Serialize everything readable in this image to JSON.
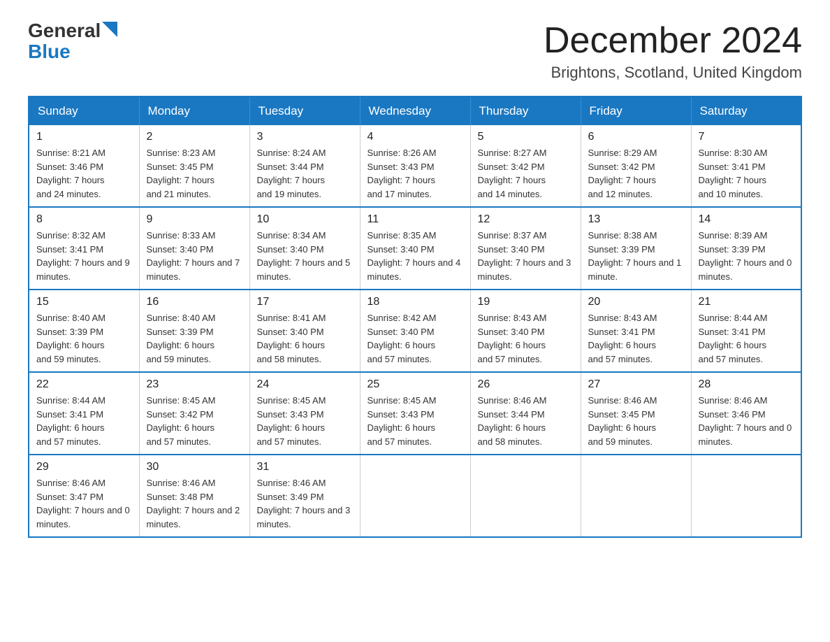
{
  "header": {
    "logo": {
      "general": "General",
      "blue": "Blue"
    },
    "title": "December 2024",
    "location": "Brightons, Scotland, United Kingdom"
  },
  "days_of_week": [
    "Sunday",
    "Monday",
    "Tuesday",
    "Wednesday",
    "Thursday",
    "Friday",
    "Saturday"
  ],
  "weeks": [
    [
      {
        "day": "1",
        "sunrise": "8:21 AM",
        "sunset": "3:46 PM",
        "daylight": "7 hours and 24 minutes."
      },
      {
        "day": "2",
        "sunrise": "8:23 AM",
        "sunset": "3:45 PM",
        "daylight": "7 hours and 21 minutes."
      },
      {
        "day": "3",
        "sunrise": "8:24 AM",
        "sunset": "3:44 PM",
        "daylight": "7 hours and 19 minutes."
      },
      {
        "day": "4",
        "sunrise": "8:26 AM",
        "sunset": "3:43 PM",
        "daylight": "7 hours and 17 minutes."
      },
      {
        "day": "5",
        "sunrise": "8:27 AM",
        "sunset": "3:42 PM",
        "daylight": "7 hours and 14 minutes."
      },
      {
        "day": "6",
        "sunrise": "8:29 AM",
        "sunset": "3:42 PM",
        "daylight": "7 hours and 12 minutes."
      },
      {
        "day": "7",
        "sunrise": "8:30 AM",
        "sunset": "3:41 PM",
        "daylight": "7 hours and 10 minutes."
      }
    ],
    [
      {
        "day": "8",
        "sunrise": "8:32 AM",
        "sunset": "3:41 PM",
        "daylight": "7 hours and 9 minutes."
      },
      {
        "day": "9",
        "sunrise": "8:33 AM",
        "sunset": "3:40 PM",
        "daylight": "7 hours and 7 minutes."
      },
      {
        "day": "10",
        "sunrise": "8:34 AM",
        "sunset": "3:40 PM",
        "daylight": "7 hours and 5 minutes."
      },
      {
        "day": "11",
        "sunrise": "8:35 AM",
        "sunset": "3:40 PM",
        "daylight": "7 hours and 4 minutes."
      },
      {
        "day": "12",
        "sunrise": "8:37 AM",
        "sunset": "3:40 PM",
        "daylight": "7 hours and 3 minutes."
      },
      {
        "day": "13",
        "sunrise": "8:38 AM",
        "sunset": "3:39 PM",
        "daylight": "7 hours and 1 minute."
      },
      {
        "day": "14",
        "sunrise": "8:39 AM",
        "sunset": "3:39 PM",
        "daylight": "7 hours and 0 minutes."
      }
    ],
    [
      {
        "day": "15",
        "sunrise": "8:40 AM",
        "sunset": "3:39 PM",
        "daylight": "6 hours and 59 minutes."
      },
      {
        "day": "16",
        "sunrise": "8:40 AM",
        "sunset": "3:39 PM",
        "daylight": "6 hours and 59 minutes."
      },
      {
        "day": "17",
        "sunrise": "8:41 AM",
        "sunset": "3:40 PM",
        "daylight": "6 hours and 58 minutes."
      },
      {
        "day": "18",
        "sunrise": "8:42 AM",
        "sunset": "3:40 PM",
        "daylight": "6 hours and 57 minutes."
      },
      {
        "day": "19",
        "sunrise": "8:43 AM",
        "sunset": "3:40 PM",
        "daylight": "6 hours and 57 minutes."
      },
      {
        "day": "20",
        "sunrise": "8:43 AM",
        "sunset": "3:41 PM",
        "daylight": "6 hours and 57 minutes."
      },
      {
        "day": "21",
        "sunrise": "8:44 AM",
        "sunset": "3:41 PM",
        "daylight": "6 hours and 57 minutes."
      }
    ],
    [
      {
        "day": "22",
        "sunrise": "8:44 AM",
        "sunset": "3:41 PM",
        "daylight": "6 hours and 57 minutes."
      },
      {
        "day": "23",
        "sunrise": "8:45 AM",
        "sunset": "3:42 PM",
        "daylight": "6 hours and 57 minutes."
      },
      {
        "day": "24",
        "sunrise": "8:45 AM",
        "sunset": "3:43 PM",
        "daylight": "6 hours and 57 minutes."
      },
      {
        "day": "25",
        "sunrise": "8:45 AM",
        "sunset": "3:43 PM",
        "daylight": "6 hours and 57 minutes."
      },
      {
        "day": "26",
        "sunrise": "8:46 AM",
        "sunset": "3:44 PM",
        "daylight": "6 hours and 58 minutes."
      },
      {
        "day": "27",
        "sunrise": "8:46 AM",
        "sunset": "3:45 PM",
        "daylight": "6 hours and 59 minutes."
      },
      {
        "day": "28",
        "sunrise": "8:46 AM",
        "sunset": "3:46 PM",
        "daylight": "7 hours and 0 minutes."
      }
    ],
    [
      {
        "day": "29",
        "sunrise": "8:46 AM",
        "sunset": "3:47 PM",
        "daylight": "7 hours and 0 minutes."
      },
      {
        "day": "30",
        "sunrise": "8:46 AM",
        "sunset": "3:48 PM",
        "daylight": "7 hours and 2 minutes."
      },
      {
        "day": "31",
        "sunrise": "8:46 AM",
        "sunset": "3:49 PM",
        "daylight": "7 hours and 3 minutes."
      },
      null,
      null,
      null,
      null
    ]
  ]
}
